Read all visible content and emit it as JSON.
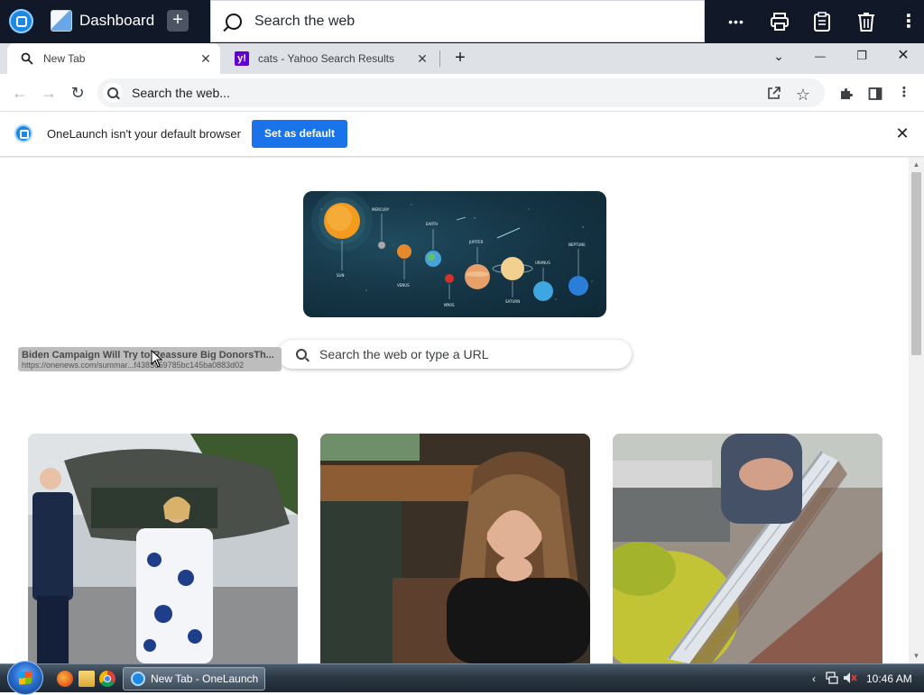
{
  "onelaunch": {
    "dashboard_label": "Dashboard",
    "add_label": "+",
    "search_placeholder": "Search the web",
    "tools": {
      "more": "•••",
      "print": "⎙",
      "clipboard": "▤",
      "trash": "🗑",
      "menu": "⋮"
    }
  },
  "tabs": [
    {
      "title": "New Tab",
      "icon": "search-icon",
      "active": true,
      "close": "✕"
    },
    {
      "title": "cats - Yahoo Search Results",
      "icon": "yahoo-favicon",
      "favicon_text": "y!",
      "active": false,
      "close": "✕"
    }
  ],
  "new_tab_button": "+",
  "window_controls": {
    "tab_search": "⌄",
    "minimize": "—",
    "restore": "❐",
    "close": "✕"
  },
  "toolbar": {
    "back": "←",
    "forward": "→",
    "reload": "↻",
    "omnibox_placeholder": "Search the web...",
    "share": "⇪",
    "bookmark": "☆",
    "extensions": "✚",
    "side_panel": "◨",
    "menu": "⋮"
  },
  "infobar": {
    "message": "OneLaunch isn't your default browser",
    "button": "Set as default",
    "close": "✕"
  },
  "page": {
    "search_placeholder": "Search the web or type a URL",
    "planet_labels": [
      "MERCURY",
      "EARTH",
      "JUPITER",
      "NEPTUNE",
      "SUN",
      "VENUS",
      "URANUS",
      "MARS",
      "SATURN"
    ],
    "tooltip": {
      "title": "Biden Campaign Will Try to Reassure Big DonorsTh...",
      "url": "https://onenews.com/summar...f4383c59785bc145ba0883d02"
    },
    "news_cards": [
      {
        "subject": "couple-walking-helicopter"
      },
      {
        "subject": "woman-in-courtroom"
      },
      {
        "subject": "gutter-guard-install"
      }
    ]
  },
  "taskbar": {
    "task_label": "New Tab - OneLaunch",
    "clock": "10:46 AM",
    "tray": {
      "chevron": "‹",
      "network": "▣",
      "volume": "🔇"
    }
  },
  "colors": {
    "onelaunch_bar": "#111827",
    "accent_blue": "#1a73e8",
    "tab_strip": "#dee1e6",
    "banner_bg": "#143343"
  }
}
